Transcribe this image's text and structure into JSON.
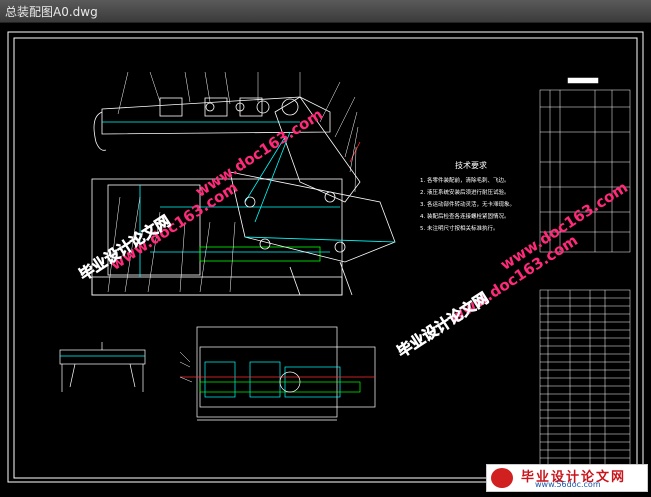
{
  "window": {
    "title": "总装配图A0.dwg"
  },
  "drawing": {
    "notes_title": "技术要求",
    "notes": [
      "1. 各零件装配前，清除毛刺、飞边。",
      "2. 液压系统安装后须进行耐压试验。",
      "3. 各运动部件转动灵活，无卡滞现象。",
      "4. 装配后检查各连接螺栓紧固情况。",
      "5. 未注明尺寸按相关标准执行。"
    ],
    "colors": {
      "line_white": "#ffffff",
      "line_cyan": "#00ffff",
      "line_green": "#00ff00",
      "line_red": "#ff3030",
      "line_yellow": "#ffff00"
    }
  },
  "watermarks": {
    "url1": "www.doc163.com",
    "cn1": "毕业设计论文网",
    "url2": "www.doc163.com",
    "cn2": "毕业设计论文网",
    "url3": "www.doc163.com",
    "cn3": "毕业设计论文网"
  },
  "logo": {
    "cn": "毕业设计论文网",
    "url": "www.56doc.com"
  }
}
